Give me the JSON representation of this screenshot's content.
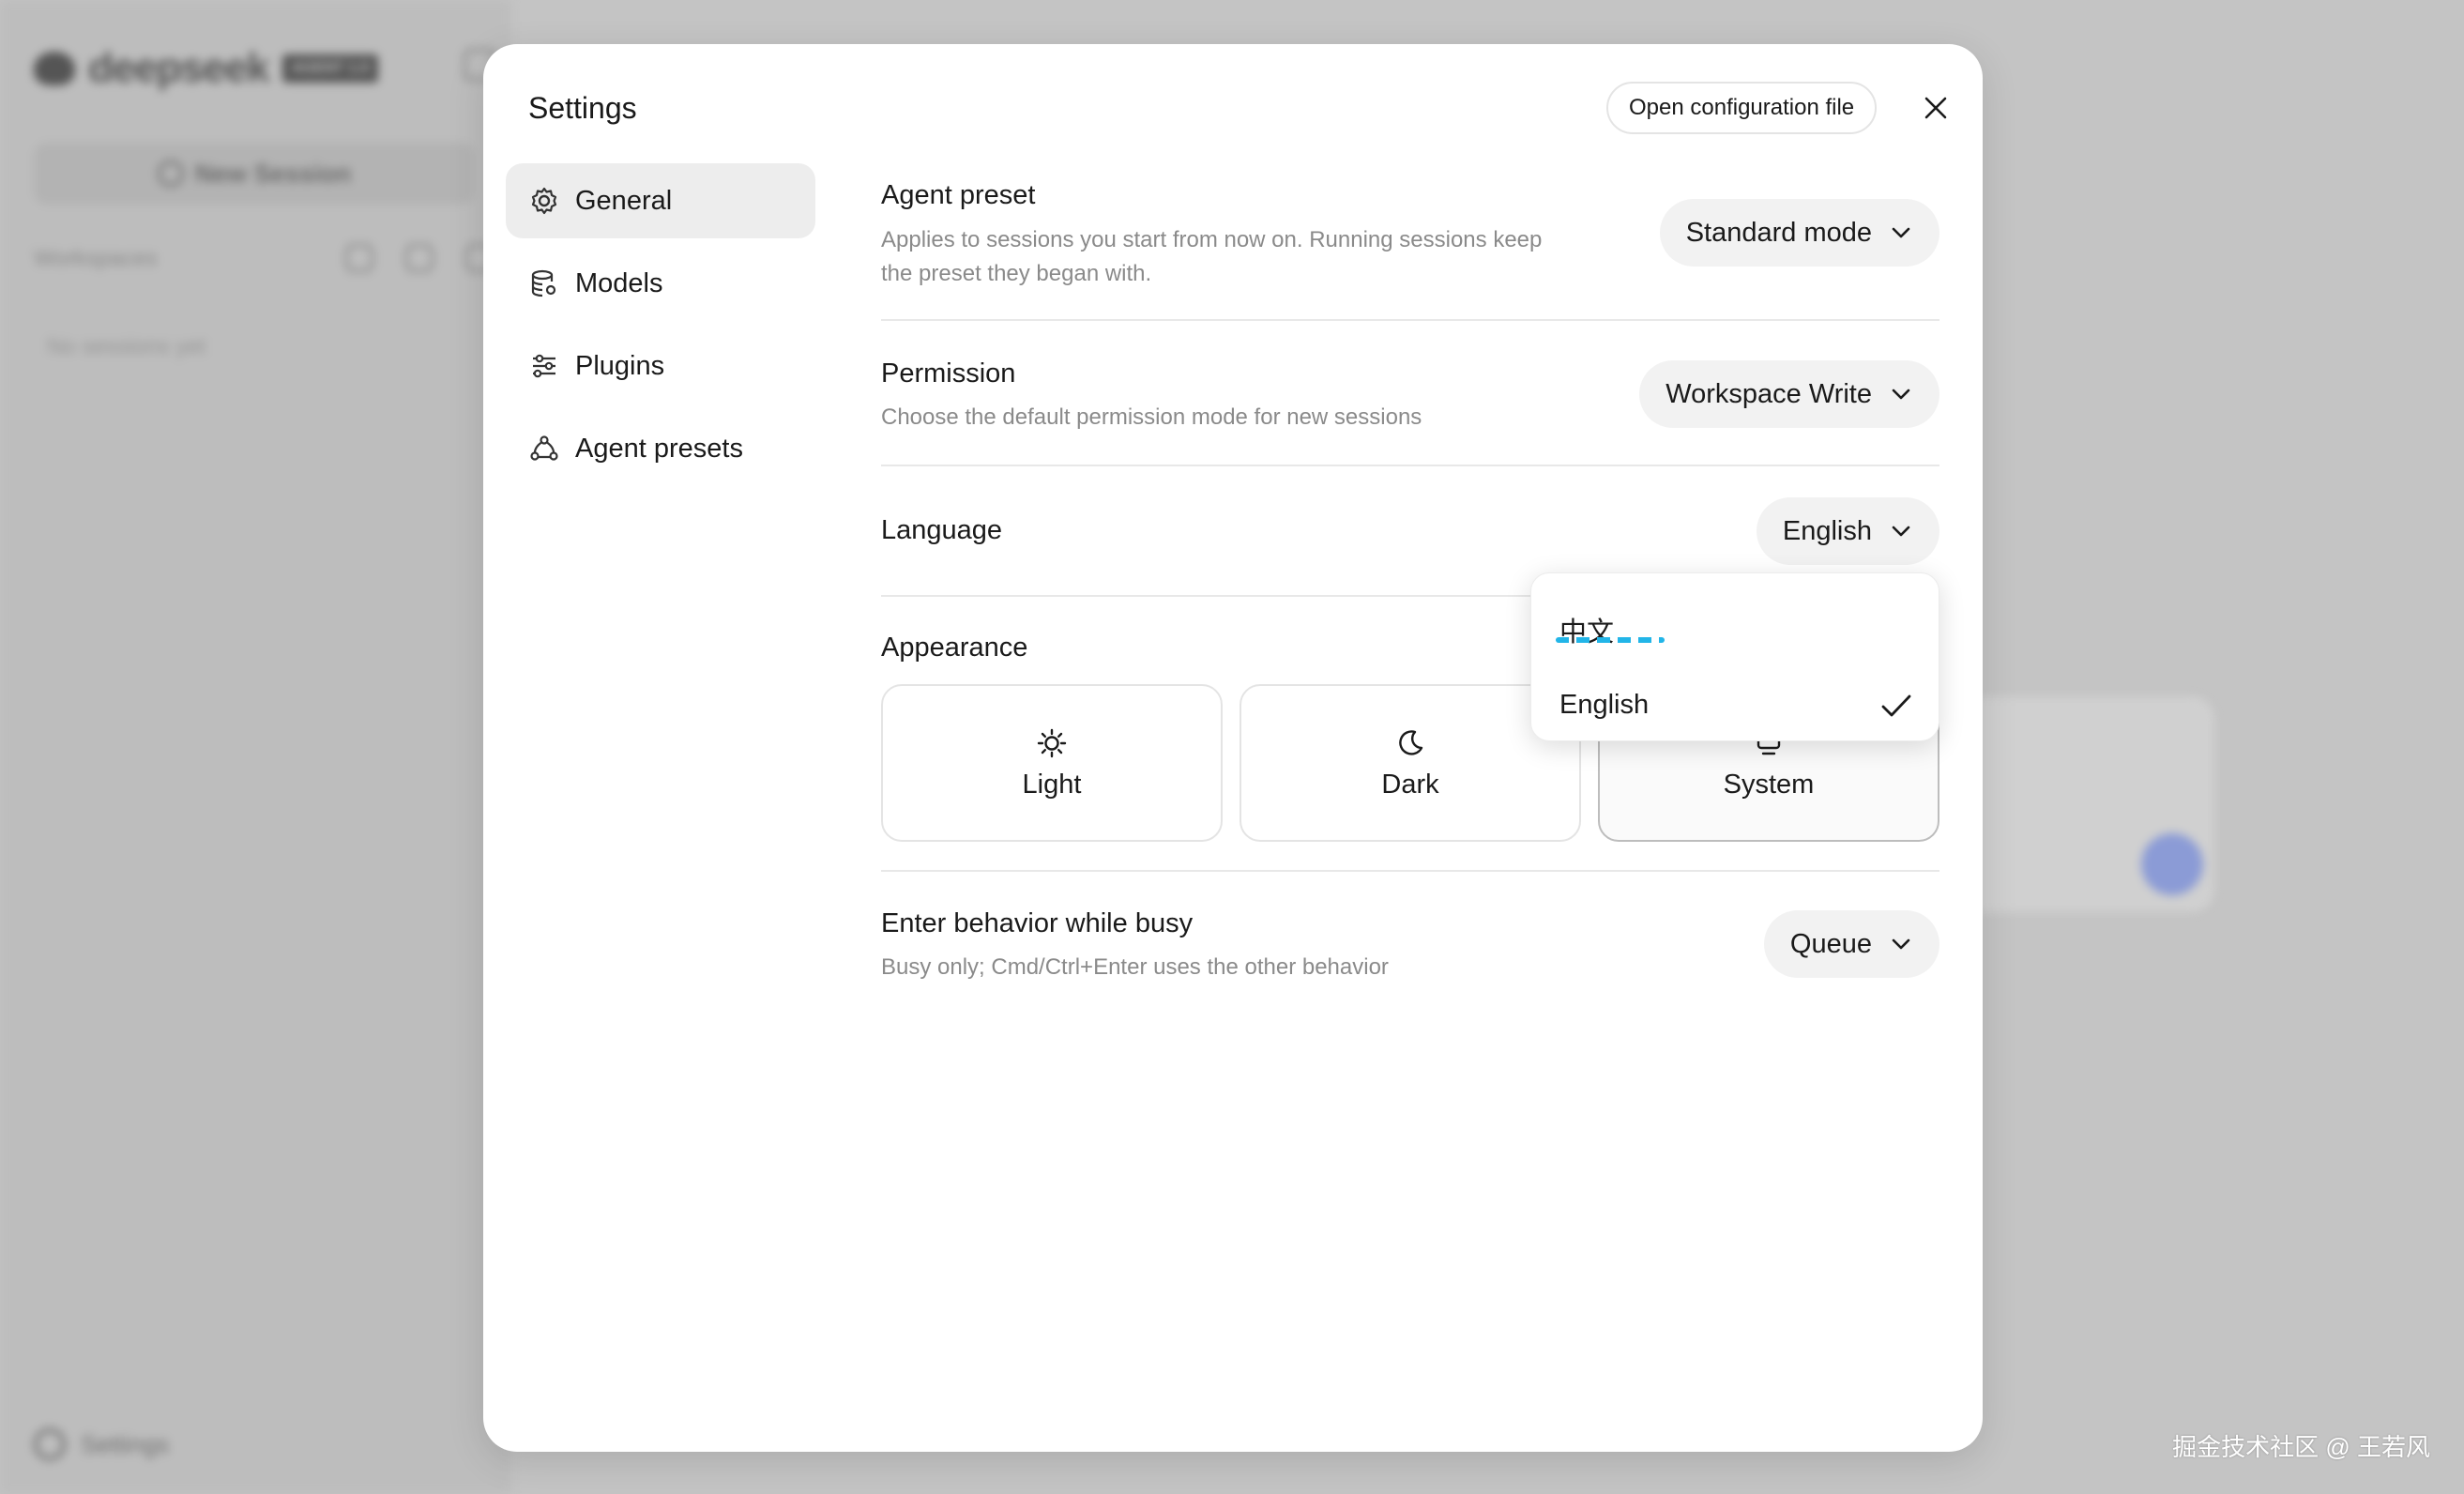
{
  "background": {
    "logo_text": "deepseek",
    "logo_badge": "AGENT 1.0",
    "new_session_label": "New Session",
    "workspaces_label": "Workspaces",
    "no_sessions": "No sessions yet",
    "settings_label": "Settings"
  },
  "watermark": "掘金技术社区 @ 王若风",
  "dialog": {
    "title": "Settings",
    "open_config_label": "Open configuration file",
    "nav": [
      {
        "label": "General",
        "icon": "gear-icon",
        "active": true
      },
      {
        "label": "Models",
        "icon": "database-icon",
        "active": false
      },
      {
        "label": "Plugins",
        "icon": "sliders-icon",
        "active": false
      },
      {
        "label": "Agent presets",
        "icon": "network-icon",
        "active": false
      }
    ],
    "sections": {
      "agent_preset": {
        "title": "Agent preset",
        "description": "Applies to sessions you start from now on. Running sessions keep the preset they began with.",
        "value": "Standard mode"
      },
      "permission": {
        "title": "Permission",
        "description": "Choose the default permission mode for new sessions",
        "value": "Workspace Write"
      },
      "language": {
        "title": "Language",
        "value": "English",
        "options": [
          {
            "label": "中文",
            "selected": false
          },
          {
            "label": "English",
            "selected": true
          }
        ]
      },
      "appearance": {
        "title": "Appearance",
        "options": [
          {
            "label": "Light",
            "icon": "sun-icon",
            "selected": false
          },
          {
            "label": "Dark",
            "icon": "moon-icon",
            "selected": false
          },
          {
            "label": "System",
            "icon": "monitor-icon",
            "selected": true
          }
        ]
      },
      "enter_behavior": {
        "title": "Enter behavior while busy",
        "description": "Busy only; Cmd/Ctrl+Enter uses the other behavior",
        "value": "Queue"
      }
    }
  },
  "colors": {
    "accent_underline": "#22b5e8",
    "active_nav_bg": "#ededed",
    "send_button": "#8b9bd6"
  }
}
